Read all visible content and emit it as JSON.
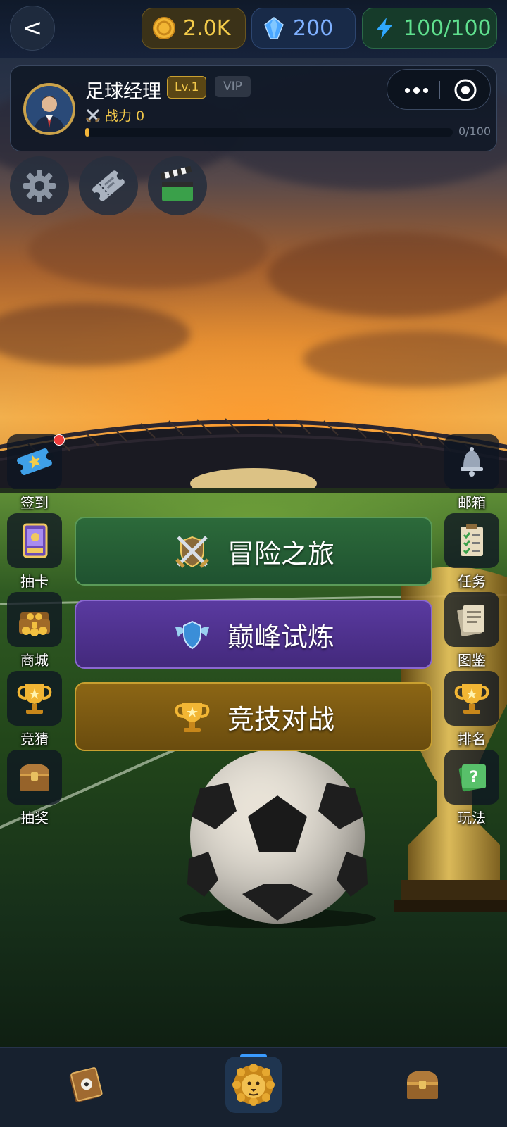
{
  "header": {
    "back_label": "<",
    "currencies": {
      "coins": "2.0K",
      "gems": "200",
      "energy": "100/100"
    }
  },
  "profile": {
    "name": "足球经理",
    "level": "Lv.1",
    "vip": "VIP",
    "power_label": "战力 0",
    "xp_text": "0/100",
    "xp_progress": 0.01
  },
  "quick_buttons": [
    "gear-icon",
    "ticket-icon",
    "clapperboard-icon"
  ],
  "left_menu": [
    {
      "label": "签到",
      "icon": "ticket-icon",
      "badge": true
    },
    {
      "label": "抽卡",
      "icon": "card-icon"
    },
    {
      "label": "商城",
      "icon": "treasure-gold-icon"
    },
    {
      "label": "竞猜",
      "icon": "trophy-icon"
    },
    {
      "label": "抽奖",
      "icon": "chest-icon"
    }
  ],
  "right_menu": [
    {
      "label": "邮箱",
      "icon": "bell-icon"
    },
    {
      "label": "任务",
      "icon": "clipboard-icon"
    },
    {
      "label": "图鉴",
      "icon": "papers-icon"
    },
    {
      "label": "排名",
      "icon": "trophy-icon"
    },
    {
      "label": "玩法",
      "icon": "help-book-icon"
    }
  ],
  "modes": [
    {
      "label": "冒险之旅",
      "icon": "crossed-swords-shield-icon",
      "color": "#2c6a3a"
    },
    {
      "label": "巅峰试炼",
      "icon": "winged-shield-icon",
      "color": "#5a3aa0"
    },
    {
      "label": "竞技对战",
      "icon": "trophy-icon",
      "color": "#8c6615"
    }
  ],
  "bottom_nav": [
    {
      "icon": "card-book-icon"
    },
    {
      "icon": "lion-icon",
      "active": true
    },
    {
      "icon": "chest-icon"
    }
  ],
  "colors": {
    "coin": "#f4cc4a",
    "gem": "#7fb0ff",
    "energy": "#5fe08e",
    "accent": "#3a9bff",
    "badge": "#ee3a3a"
  }
}
